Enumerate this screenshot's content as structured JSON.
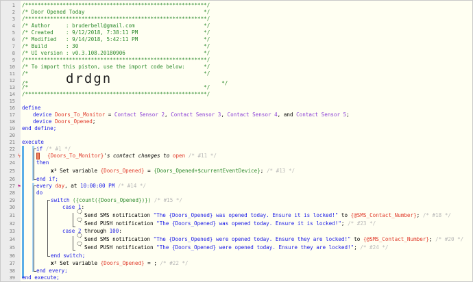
{
  "line_numbers": [
    "1",
    "2",
    "3",
    "4",
    "5",
    "6",
    "7",
    "8",
    "9",
    "10",
    "11",
    "12",
    "13",
    "14",
    "15",
    "16",
    "17",
    "18",
    "19",
    "20",
    "21",
    "22",
    "23",
    "24",
    "25",
    "26",
    "27",
    "28",
    "29",
    "30",
    "31",
    "32",
    "33",
    "34",
    "35",
    "36",
    "37",
    "38",
    "39"
  ],
  "header": {
    "l1": "/**********************************************************/",
    "l2": "/* Door Opened Today                                      */",
    "l3": "/**********************************************************/",
    "l4": "/* Author     : bruderbell@gmail.com                      */",
    "l5": "/* Created    : 9/12/2018, 7:38:11 PM                     */",
    "l6": "/* Modified   : 9/14/2018, 5:42:11 PM                     */",
    "l7": "/* Build      : 30                                        */",
    "l8": "/* UI version : v0.3.108.20180906                         */",
    "l9": "/**********************************************************/",
    "l10": "/* To import this piston, use the import code below:      */",
    "l11": "/*                                                        */",
    "l12_pre": "/*            ",
    "l12_code": "drdgn",
    "l12_post": "                                   */",
    "l13": "/*                                                        */",
    "l14": "/**********************************************************/"
  },
  "define": {
    "kw": "define",
    "device_kw": "device",
    "var1": "Doors_To_Monitor",
    "eq": " = ",
    "d1": "Contact Sensor 2",
    "d2": "Contact Sensor 3",
    "d3": "Contact Sensor 4",
    "and": ", and ",
    "d4": "Contact Sensor 5",
    "comma": ", ",
    "semi": ";",
    "var2": "Doors_Opened",
    "end": "end define;"
  },
  "execute": {
    "kw": "execute",
    "if": "if",
    "c1": "/* #1 */",
    "cond_var": "{Doors_To_Monitor}",
    "cond_mid": "'s contact changes to ",
    "cond_val": "open",
    "c11": "/* #11 */",
    "then": "then",
    "setvar_label": "Set variable ",
    "setvar_name": "{Doors_Opened}",
    "setvar_eq": " = ",
    "setvar_expr": "{Doors_Opened+$currentEventDevice}",
    "setvar_semi": ";",
    "c13": "/* #13 */",
    "endif": "end if;",
    "every": "every",
    "day": " day",
    "at": ", at ",
    "time": "10:00:00 PM",
    "c14": "/* #14 */",
    "do": "do",
    "switch": "switch",
    "switch_expr": " ({count({Doors_Opened})})",
    "c15": "/* #15 */",
    "case1": "case",
    "case1_val": " 1",
    "case1_colon": ":",
    "sms1_label": "Send SMS notification ",
    "sms1_text": "\"The {Doors_Opened} was opened today. Ensure it is locked!\"",
    "to": " to ",
    "sms1_num": "{@SMS_Contact_Number}",
    "sms1_semi": ";",
    "c18": "/* #18 */",
    "push1_label": "Send PUSH notification ",
    "push1_text": "\"The {Doors_Opened} was opened today. Ensure it is locked!\"",
    "push1_semi": ";",
    "c23": "/* #23 */",
    "case2": "case",
    "case2_val": " 2",
    "through": " through ",
    "case2_max": "100",
    "case2_colon": ":",
    "sms2_label": "Send SMS notification ",
    "sms2_text": "\"The {Doors_Opened} were opened today. Ensure they are locked!\"",
    "sms2_num": "{@SMS_Contact_Number}",
    "sms2_semi": ";",
    "c20": "/* #20 */",
    "push2_label": "Send PUSH notification ",
    "push2_text": "\"The {Doors_Opened} were opened today. Ensure they are locked!\"",
    "push2_semi": ";",
    "c24": "/* #24 */",
    "endswitch": "end switch;",
    "setvar2_label": "Set variable ",
    "setvar2_name": "{Doors_Opened}",
    "setvar2_tail": " = ;",
    "c22": "/* #22 */",
    "endevery": "end every;",
    "endexecute": "end execute;"
  },
  "icons": {
    "variable": "x²",
    "notify": "speech-bubble-icon",
    "trigger": "lightning-icon",
    "timer": "flag-icon"
  },
  "colors": {
    "comment": "#2e8b2e",
    "keyword": "#1a1ae6",
    "variable": "#e03a2a",
    "device": "#8a3fd6",
    "background": "#fffff2"
  }
}
